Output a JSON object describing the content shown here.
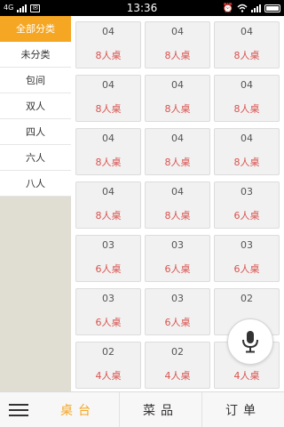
{
  "status_bar": {
    "network": "4G",
    "time": "13:36"
  },
  "sidebar": {
    "categories": [
      {
        "label": "全部分类",
        "active": true
      },
      {
        "label": "未分类",
        "active": false
      },
      {
        "label": "包间",
        "active": false
      },
      {
        "label": "双人",
        "active": false
      },
      {
        "label": "四人",
        "active": false
      },
      {
        "label": "六人",
        "active": false
      },
      {
        "label": "八人",
        "active": false
      }
    ]
  },
  "tables": [
    {
      "seats": "04",
      "name": "8人桌"
    },
    {
      "seats": "04",
      "name": "8人桌"
    },
    {
      "seats": "04",
      "name": "8人桌"
    },
    {
      "seats": "04",
      "name": "8人桌"
    },
    {
      "seats": "04",
      "name": "8人桌"
    },
    {
      "seats": "04",
      "name": "8人桌"
    },
    {
      "seats": "04",
      "name": "8人桌"
    },
    {
      "seats": "04",
      "name": "8人桌"
    },
    {
      "seats": "04",
      "name": "8人桌"
    },
    {
      "seats": "04",
      "name": "8人桌"
    },
    {
      "seats": "04",
      "name": "8人桌"
    },
    {
      "seats": "03",
      "name": "6人桌"
    },
    {
      "seats": "03",
      "name": "6人桌"
    },
    {
      "seats": "03",
      "name": "6人桌"
    },
    {
      "seats": "03",
      "name": "6人桌"
    },
    {
      "seats": "03",
      "name": "6人桌"
    },
    {
      "seats": "03",
      "name": "6人桌"
    },
    {
      "seats": "02",
      "name": ""
    },
    {
      "seats": "02",
      "name": "4人桌"
    },
    {
      "seats": "02",
      "name": "4人桌"
    },
    {
      "seats": "",
      "name": "4人桌"
    }
  ],
  "bottom_tabs": [
    {
      "label": "桌台",
      "active": true
    },
    {
      "label": "菜品",
      "active": false
    },
    {
      "label": "订单",
      "active": false
    }
  ],
  "colors": {
    "accent": "#f5a623",
    "table_name": "#d9534f",
    "sidebar_bg": "#e0ddd2"
  },
  "icons": {
    "menu": "menu-icon",
    "mic": "microphone-icon"
  }
}
